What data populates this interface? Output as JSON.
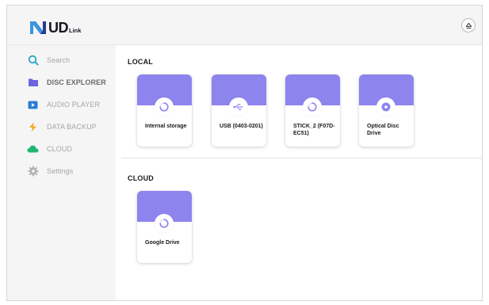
{
  "header": {
    "logo_text": "UD",
    "logo_sub": "Link",
    "eject_icon": "eject-icon"
  },
  "sidebar": {
    "items": [
      {
        "label": "Search",
        "icon": "search-icon",
        "active": false
      },
      {
        "label": "DISC EXPLORER",
        "icon": "folder-icon",
        "active": true
      },
      {
        "label": "AUDIO PLAYER",
        "icon": "play-icon",
        "active": false
      },
      {
        "label": "DATA BACKUP",
        "icon": "backup-icon",
        "active": false
      },
      {
        "label": "CLOUD",
        "icon": "cloud-icon",
        "active": false
      },
      {
        "label": "Settings",
        "icon": "gear-icon",
        "active": false
      }
    ]
  },
  "main": {
    "local": {
      "title": "LOCAL",
      "drives": [
        {
          "label": "Internal storage",
          "icon": "spinner-icon"
        },
        {
          "label": "USB (0403-0201)",
          "icon": "usb-icon"
        },
        {
          "label": "STICK_2 (F07D-EC51)",
          "icon": "spinner-icon"
        },
        {
          "label": "Optical Disc Drive",
          "icon": "disc-icon"
        }
      ]
    },
    "cloud": {
      "title": "CLOUD",
      "drives": [
        {
          "label": "Google Drive",
          "icon": "spinner-icon"
        }
      ]
    }
  },
  "colors": {
    "accent": "#8d84ee",
    "sidebar_bg": "#f5f5f5",
    "search": "#2aa7c9",
    "folder": "#6c63e0",
    "play": "#2a7fd4",
    "backup": "#f5a623",
    "cloud": "#21b573",
    "settings": "#b3b3b3"
  }
}
